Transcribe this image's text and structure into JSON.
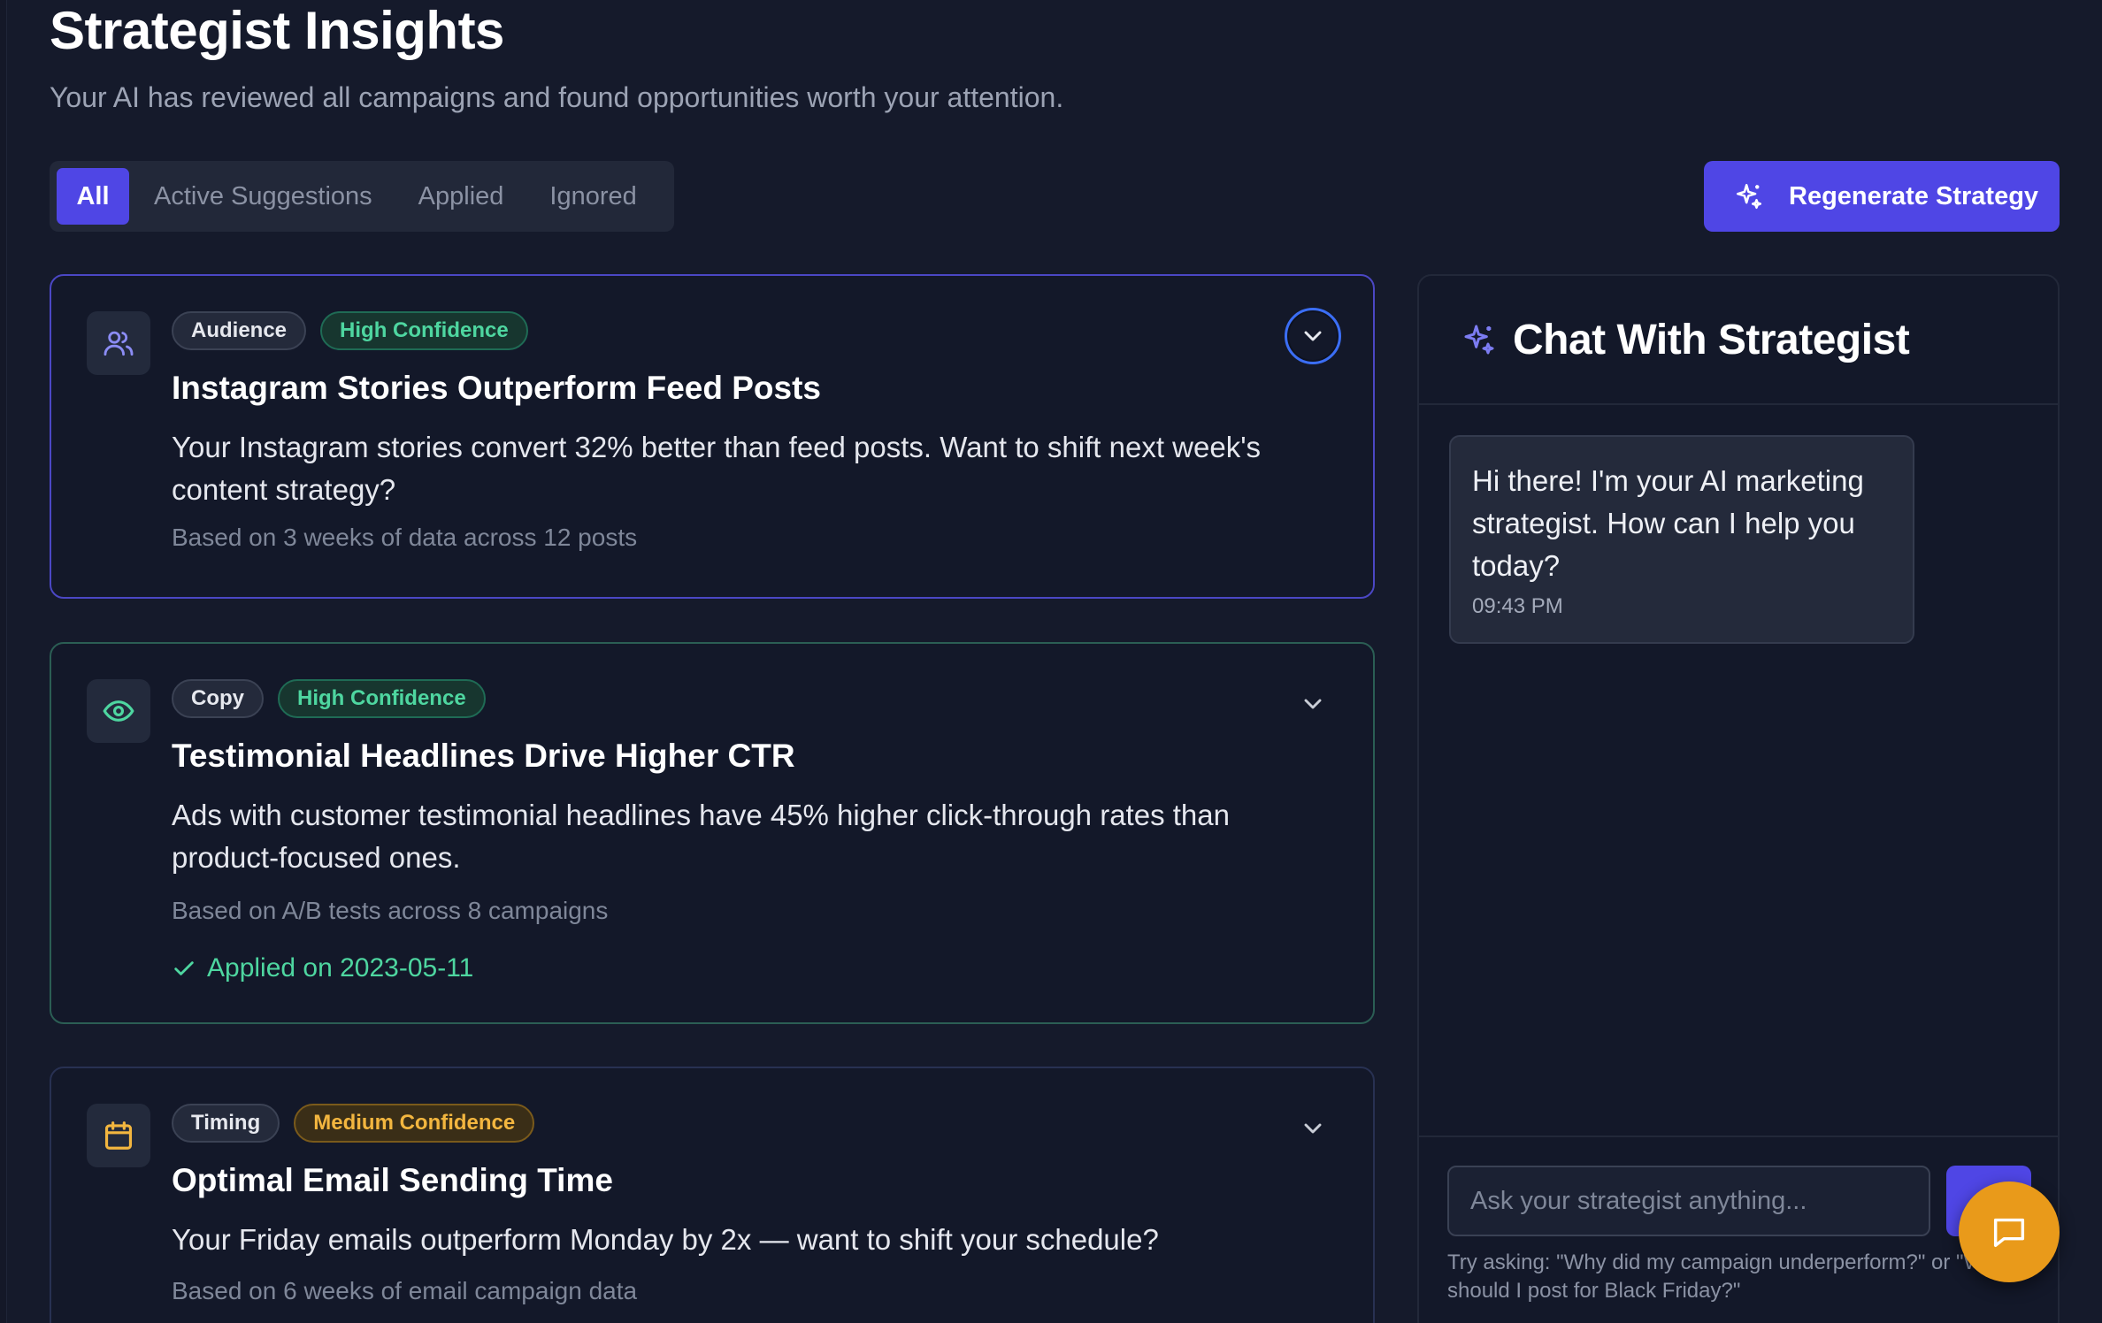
{
  "header": {
    "title": "Strategist Insights",
    "subtitle": "Your AI has reviewed all campaigns and found opportunities worth your attention."
  },
  "filters": {
    "tabs": [
      "All",
      "Active Suggestions",
      "Applied",
      "Ignored"
    ],
    "active": "All"
  },
  "actions": {
    "regenerate_label": "Regenerate Strategy"
  },
  "insights": [
    {
      "icon": "users-icon",
      "category": "Audience",
      "confidence": "High Confidence",
      "title": "Instagram Stories Outperform Feed Posts",
      "description": "Your Instagram stories convert 32% better than feed posts. Want to shift next week's content strategy?",
      "basis": "Based on 3 weeks of data across 12 posts"
    },
    {
      "icon": "eye-icon",
      "category": "Copy",
      "confidence": "High Confidence",
      "title": "Testimonial Headlines Drive Higher CTR",
      "description": "Ads with customer testimonial headlines have 45% higher click-through rates than product-focused ones.",
      "basis": "Based on A/B tests across 8 campaigns",
      "applied": "Applied on 2023-05-11"
    },
    {
      "icon": "calendar-icon",
      "category": "Timing",
      "confidence": "Medium Confidence",
      "title": "Optimal Email Sending Time",
      "description": "Your Friday emails outperform Monday by 2x — want to shift your schedule?",
      "basis": "Based on 6 weeks of email campaign data"
    }
  ],
  "chat": {
    "title": "Chat With Strategist",
    "messages": [
      {
        "text": "Hi there! I'm your AI marketing strategist. How can I help you today?",
        "time": "09:43 PM"
      }
    ],
    "input_placeholder": "Ask your strategist anything...",
    "hint": "Try asking: \"Why did my campaign underperform?\" or \"What should I post for Black Friday?\""
  },
  "colors": {
    "accent": "#4f46e5",
    "success": "#4ed6a0",
    "warning": "#f3b63f",
    "fab": "#e99a1a",
    "background": "#151a2b"
  }
}
